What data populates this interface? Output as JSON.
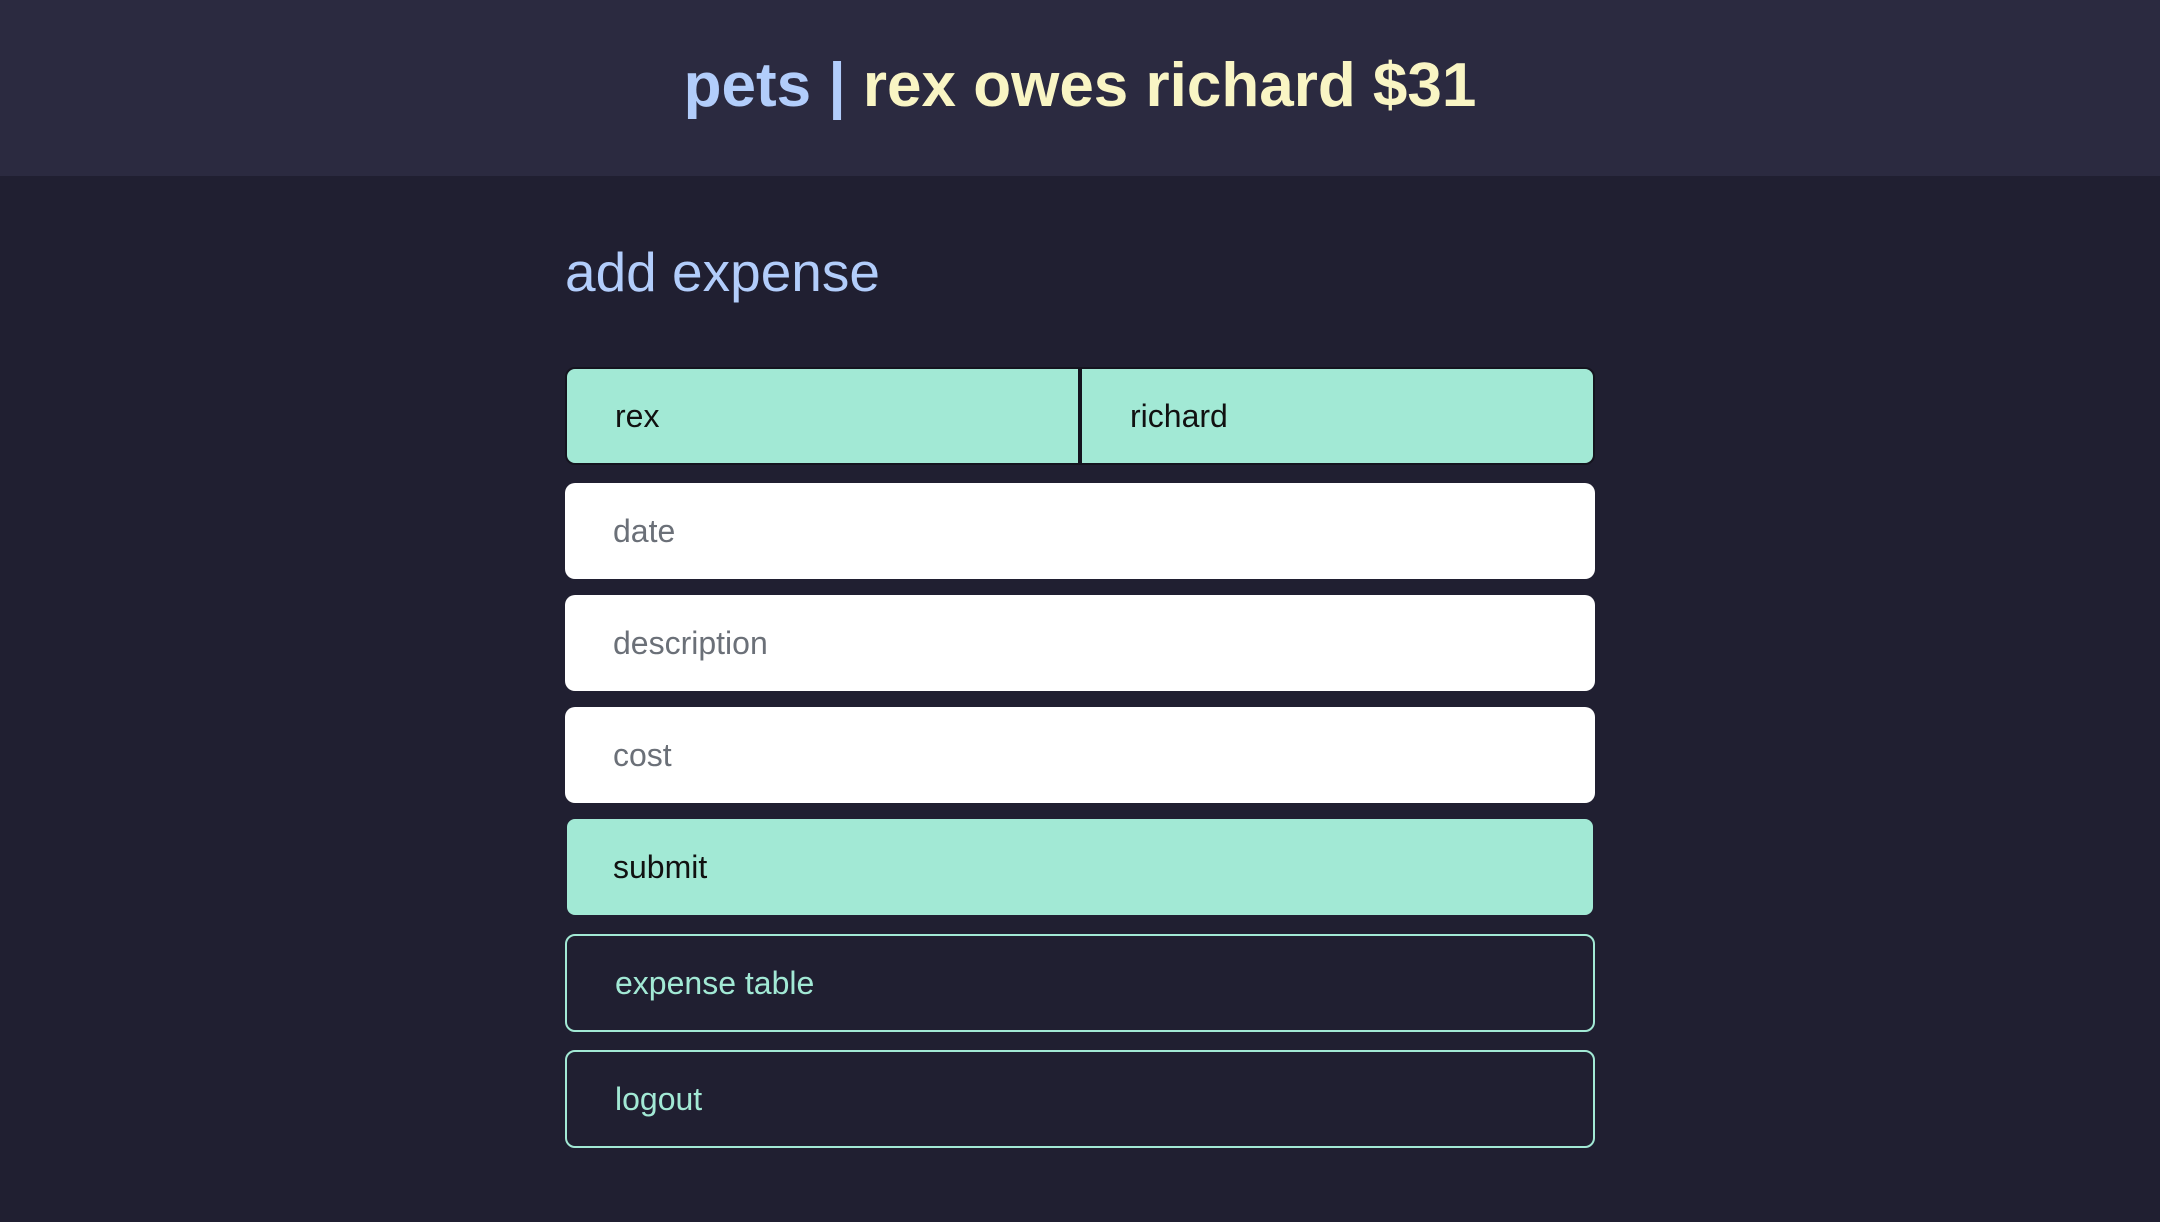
{
  "header": {
    "group_name": "pets",
    "separator": " | ",
    "balance_text": "rex owes richard $31"
  },
  "main": {
    "section_title": "add expense",
    "payer_toggle": {
      "options": [
        "rex",
        "richard"
      ]
    },
    "fields": {
      "date_placeholder": "date",
      "description_placeholder": "description",
      "cost_placeholder": "cost"
    },
    "submit_label": "submit",
    "expense_table_label": "expense table",
    "logout_label": "logout"
  },
  "colors": {
    "background": "#201f31",
    "header_background": "#2b2a40",
    "accent_mint": "#a2e9d5",
    "title_blue": "#b2cdfb",
    "title_yellow": "#f9f5c4"
  }
}
